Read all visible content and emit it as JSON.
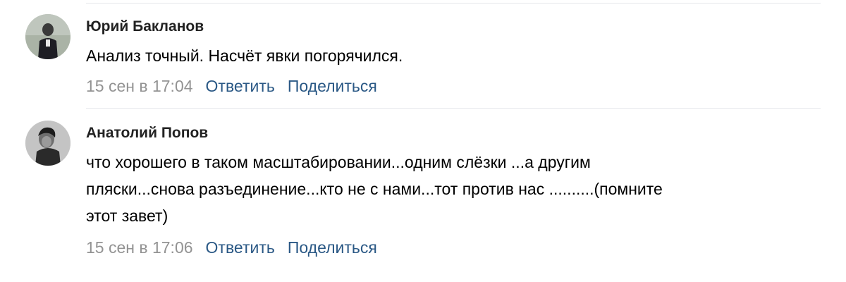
{
  "comments": [
    {
      "author": "Юрий Бакланов",
      "text": "Анализ точный. Насчёт явки погорячился.",
      "date": "15 сен в 17:04",
      "reply_label": "Ответить",
      "share_label": "Поделиться",
      "avatar_icon": "user-photo-icon"
    },
    {
      "author": "Анатолий Попов",
      "text_lines": [
        "что хорошего в таком масштабировании...одним слёзки ...а другим",
        "пляски...снова разъединение...кто не с нами...тот против нас ..........(помните",
        "этот завет)"
      ],
      "date": "15 сен в 17:06",
      "reply_label": "Ответить",
      "share_label": "Поделиться",
      "avatar_icon": "user-photo-icon"
    }
  ],
  "colors": {
    "link": "#2a5885",
    "date": "#939393",
    "divider": "#e7e8ec",
    "author": "#222222"
  }
}
